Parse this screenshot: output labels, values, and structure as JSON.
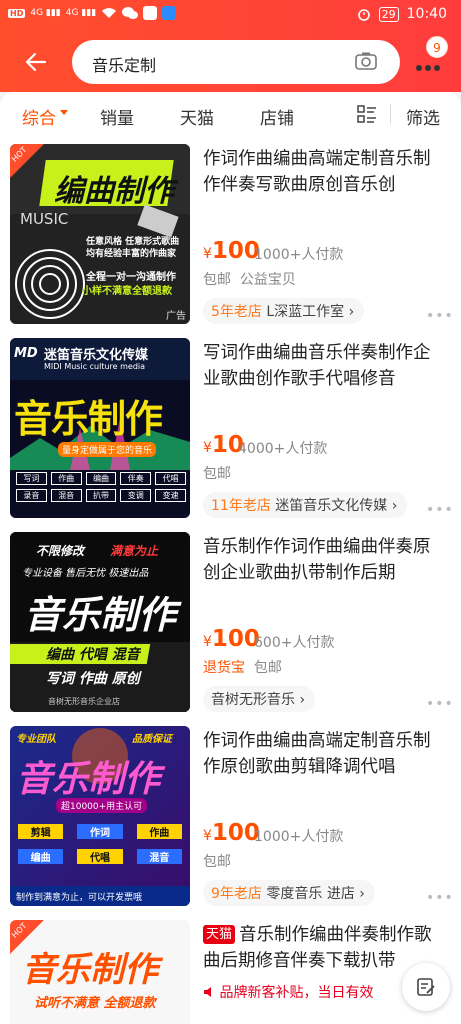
{
  "status": {
    "left": "HD HD 4G 4G",
    "time": "10:40",
    "battery": "29"
  },
  "search": {
    "query": "音乐定制",
    "cart_badge": "9"
  },
  "tabs": [
    "综合",
    "销量",
    "天猫",
    "店铺",
    "筛选"
  ],
  "items": [
    {
      "title": "作词作曲编曲高端定制音乐制作伴奏写歌曲原创音乐创",
      "price_symbol": "¥",
      "price": "100",
      "sales": "1000+人付款",
      "tags": "包邮",
      "tag_extra": "公益宝贝",
      "shop_age": "5年老店",
      "shop_name": "L深蓝工作室",
      "thumb_title": "编曲制作",
      "thumb_sub": "MUSIC",
      "thumb_line1": "任意风格 任意形式歌曲",
      "thumb_line2": "均有经验丰富的作曲家",
      "thumb_line3": "全程一对一沟通制作",
      "thumb_line4": "小样不满意全额退款",
      "hot": "HOT",
      "ad": "广告"
    },
    {
      "title": "写词作曲编曲音乐伴奏制作企业歌曲创作歌手代唱修音",
      "price_symbol": "¥",
      "price": "10",
      "sales": "4000+人付款",
      "tags": "包邮",
      "shop_age": "11年老店",
      "shop_name": "迷笛音乐文化传媒",
      "thumb_brand": "迷笛音乐文化传媒",
      "thumb_brand_en": "MIDI Music culture media",
      "thumb_title": "音乐制作",
      "thumb_sub": "量身定做属于您的音乐",
      "thumb_grid": [
        "写词",
        "作曲",
        "编曲",
        "伴奏",
        "代唱",
        "录音",
        "混音",
        "扒带",
        "变调",
        "变速"
      ]
    },
    {
      "title": "音乐制作作词作曲编曲伴奏原创企业歌曲扒带制作后期",
      "price_symbol": "¥",
      "price": "100",
      "sales": "600+人付款",
      "tag_red": "退货宝",
      "tags": "包邮",
      "shop_name": "音树无形音乐",
      "thumb_top": "不限修改",
      "thumb_top2": "满意为止",
      "thumb_l2": "专业设备 售后无忧 极速出品",
      "thumb_title": "音乐制作",
      "thumb_l3": "编曲 代唱 混音",
      "thumb_l4": "写词 作曲 原创",
      "thumb_l5": "音树无形音乐企业店"
    },
    {
      "title": "作词作曲编曲高端定制音乐制作原创歌曲剪辑降调代唱",
      "price_symbol": "¥",
      "price": "100",
      "sales": "1000+人付款",
      "tags": "包邮",
      "shop_age": "9年老店",
      "shop_name": "零度音乐",
      "shop_enter": "进店",
      "thumb_top": "专业团队",
      "thumb_top2": "品质保证",
      "thumb_title": "音乐制作",
      "thumb_badge": "超10000+用主认可",
      "thumb_grid": [
        "剪辑",
        "作词",
        "作曲",
        "编曲",
        "代唱",
        "混音"
      ],
      "thumb_bottom": "制作到满意为止，可以开发票哦"
    },
    {
      "tmall": "天猫",
      "title": "音乐制作编曲伴奏制作歌曲后期修音伴奏下载扒带",
      "promo": "品牌新客补贴，当日有效",
      "thumb_title": "音乐制作",
      "thumb_sub": "试听不满意 全额退款",
      "hot": "HOT"
    }
  ],
  "colors": {
    "accent": "#ff5000",
    "header": "#ff4e2c"
  }
}
